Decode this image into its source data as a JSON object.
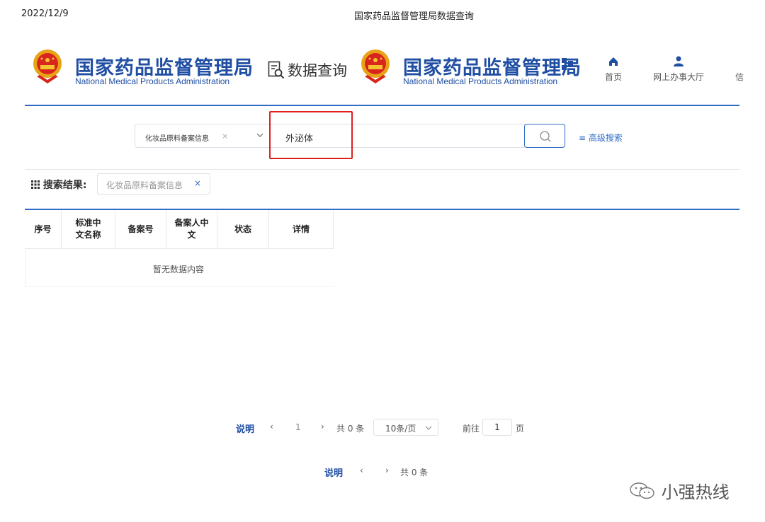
{
  "print_header": {
    "date": "2022/12/9",
    "title": "国家药品监督管理局数据查询"
  },
  "header": {
    "logo_cn": "国家药品监督管理局",
    "logo_en": "National Medical Products Administration",
    "data_query_label": "数据查询",
    "nav": [
      {
        "label": "首页"
      },
      {
        "label": "网上办事大厅"
      },
      {
        "label": "信"
      }
    ]
  },
  "colors": {
    "brand": "#1f4ea3",
    "accent": "#2f6cc6",
    "highlight": "#e02020"
  },
  "search": {
    "category_selected": "化妆品原料备案信息",
    "category_clear": "×",
    "query_value": "外泌体",
    "advanced_label": "高级搜索"
  },
  "results": {
    "label": "搜索结果:",
    "tag_text": "化妆品原料备案信息",
    "tag_close": "×"
  },
  "table": {
    "columns": [
      "序号",
      "标准中文名称",
      "备案号",
      "备案人中文",
      "状态",
      "详情"
    ],
    "empty_text": "暂无数据内容"
  },
  "pagination_full": {
    "explain": "说明",
    "prev": "‹",
    "page": "1",
    "next": "›",
    "total": "共 0 条",
    "page_size": "10条/页",
    "goto_label": "前往",
    "goto_value": "1",
    "page_suffix": "页"
  },
  "pagination_short": {
    "explain": "说明",
    "prev": "‹",
    "next": "›",
    "total": "共 0 条"
  },
  "watermark": "小强热线"
}
